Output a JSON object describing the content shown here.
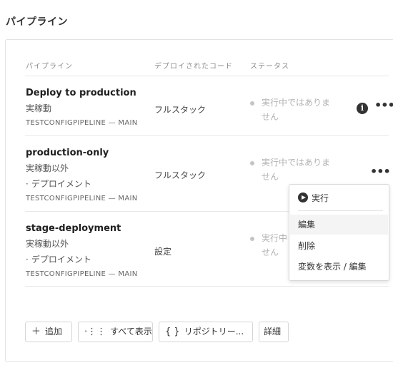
{
  "page": {
    "title": "パイプライン"
  },
  "table": {
    "headers": [
      "パイプライン",
      "デプロイされたコード",
      "ステータス"
    ],
    "rows": [
      {
        "name": "Deploy to production",
        "state": "実稼動",
        "sub": "",
        "repo": "TESTCONFIGPIPELINE — MAIN",
        "code": "フルスタック",
        "status": "実行中ではありません",
        "status_line1": "実行中ではありま",
        "status_line2": "せん"
      },
      {
        "name": "production-only",
        "state": "実稼動以外",
        "sub": "デプロイメント",
        "repo": "TESTCONFIGPIPELINE — MAIN",
        "code": "フルスタック",
        "status": "実行中ではありません",
        "status_line1": "実行中ではありま",
        "status_line2": "せん"
      },
      {
        "name": "stage-deployment",
        "state": "実稼動以外",
        "sub": "デプロイメント",
        "repo": "TESTCONFIGPIPELINE — MAIN",
        "code": "設定",
        "status": "実行中ではありません",
        "status_line1": "実行中",
        "status_line2": "せん"
      }
    ]
  },
  "toolbar": {
    "add": "追加",
    "show_all": "すべて表示",
    "repository": "リポジトリー...",
    "details": "詳細"
  },
  "context_menu": {
    "run": "実行",
    "edit": "編集",
    "delete": "削除",
    "vars": "変数を表示 / 編集"
  },
  "icons": {
    "info": "info-icon",
    "more": "more-icon",
    "play": "play-icon",
    "add": "plus-icon",
    "all": "list-icon",
    "repo": "braces-icon"
  }
}
